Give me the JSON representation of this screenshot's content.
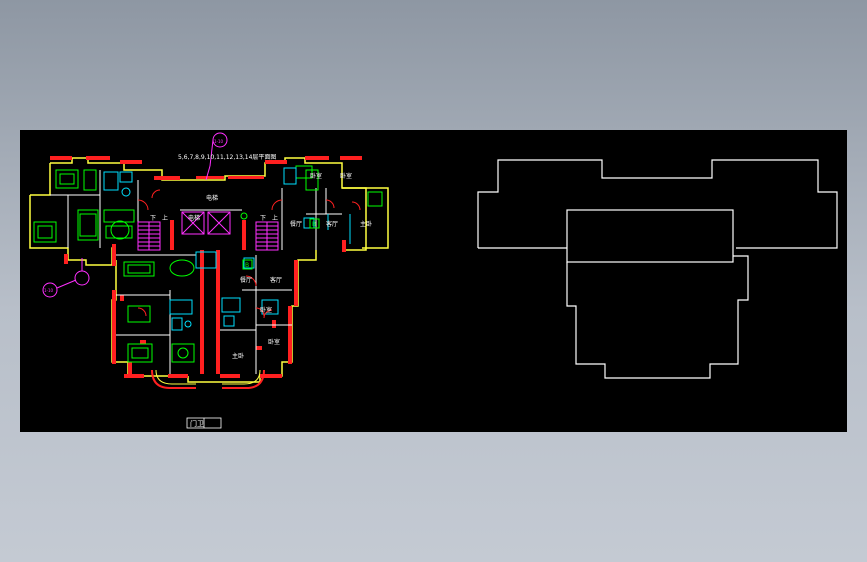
{
  "drawing": {
    "title_note": "5,6,7,8,9,10,11,12,13,14层平面图",
    "callout_top": "1-10",
    "callout_left": "1-10",
    "room_labels": {
      "bedroom": "卧室",
      "master_bedroom": "主卧",
      "living_room": "客厅",
      "dining_room": "餐厅",
      "elevator_1": "电梯",
      "elevator_2": "电梯",
      "stair_down_1": "下",
      "stair_up_1": "上",
      "stair_down_2": "下",
      "stair_up_2": "上",
      "shaft_b1": "B",
      "shaft_b2": "B"
    },
    "bottom_tag": "门卫"
  },
  "colors": {
    "background": "#000000",
    "wall_red": "#ff2020",
    "wall_yellow": "#ffff40",
    "furniture_green": "#00ff00",
    "fixture_cyan": "#00e0ff",
    "annotation_magenta": "#ff30ff",
    "outline_white": "#ffffff"
  }
}
